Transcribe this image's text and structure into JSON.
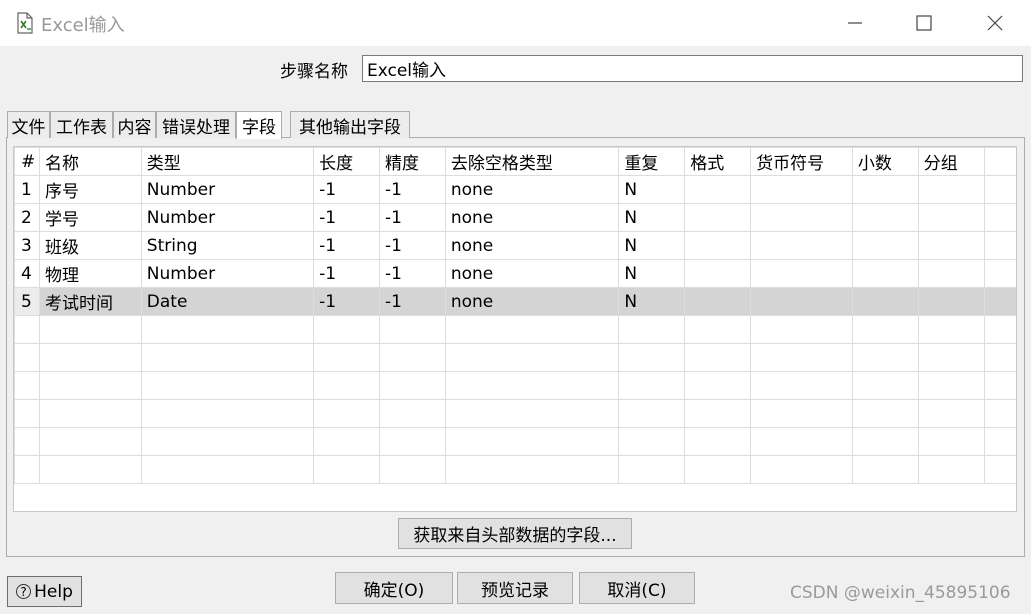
{
  "window": {
    "title": "Excel输入",
    "icon": "excel-file-icon",
    "controls": {
      "minimize": "minimize-icon",
      "maximize": "maximize-icon",
      "close": "close-icon"
    }
  },
  "step_name": {
    "label": "步骤名称",
    "value": "Excel输入"
  },
  "tabs": [
    {
      "label": "文件"
    },
    {
      "label": "工作表"
    },
    {
      "label": "内容"
    },
    {
      "label": "错误处理"
    },
    {
      "label": "字段",
      "active": true
    },
    {
      "label": "其他输出字段"
    }
  ],
  "table": {
    "index_header": "#",
    "columns": [
      "名称",
      "类型",
      "长度",
      "精度",
      "去除空格类型",
      "重复",
      "格式",
      "货币符号",
      "小数",
      "分组"
    ],
    "rows": [
      {
        "index": "1",
        "cells": [
          "序号",
          "Number",
          "-1",
          "-1",
          "none",
          "N",
          "",
          "",
          "",
          ""
        ]
      },
      {
        "index": "2",
        "cells": [
          "学号",
          "Number",
          "-1",
          "-1",
          "none",
          "N",
          "",
          "",
          "",
          ""
        ]
      },
      {
        "index": "3",
        "cells": [
          "班级",
          "String",
          "-1",
          "-1",
          "none",
          "N",
          "",
          "",
          "",
          ""
        ]
      },
      {
        "index": "4",
        "cells": [
          "物理",
          "Number",
          "-1",
          "-1",
          "none",
          "N",
          "",
          "",
          "",
          ""
        ]
      },
      {
        "index": "5",
        "cells": [
          "考试时间",
          "Date",
          "-1",
          "-1",
          "none",
          "N",
          "",
          "",
          "",
          ""
        ],
        "selected": true
      }
    ]
  },
  "buttons": {
    "get_fields": "获取来自头部数据的字段...",
    "help": "Help",
    "ok": "确定(O)",
    "preview": "预览记录",
    "cancel": "取消(C)"
  },
  "watermark": "CSDN @weixin_45895106"
}
